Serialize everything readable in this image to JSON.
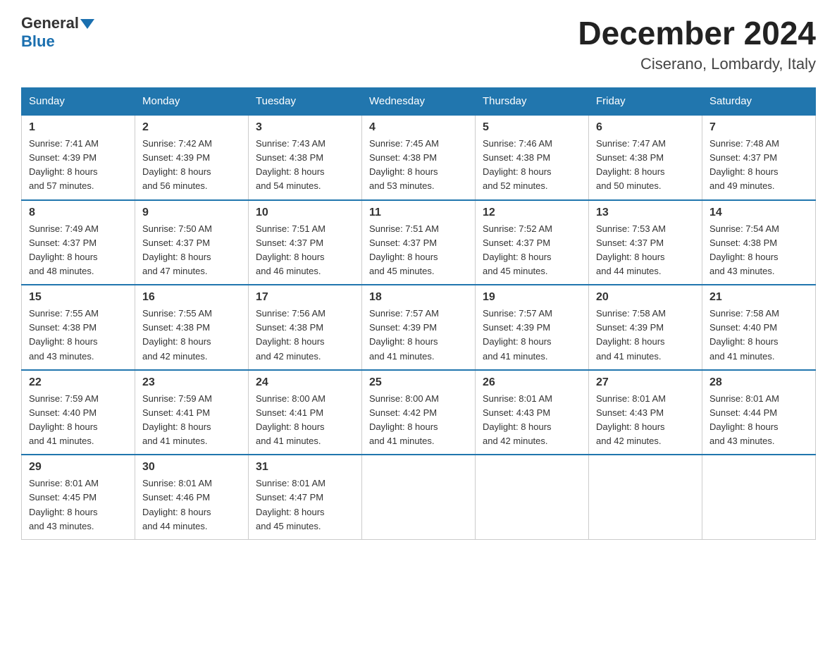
{
  "logo": {
    "line1": "General",
    "line2": "Blue"
  },
  "title": "December 2024",
  "subtitle": "Ciserano, Lombardy, Italy",
  "days_of_week": [
    "Sunday",
    "Monday",
    "Tuesday",
    "Wednesday",
    "Thursday",
    "Friday",
    "Saturday"
  ],
  "weeks": [
    [
      {
        "num": "1",
        "sunrise": "7:41 AM",
        "sunset": "4:39 PM",
        "daylight": "8 hours and 57 minutes."
      },
      {
        "num": "2",
        "sunrise": "7:42 AM",
        "sunset": "4:39 PM",
        "daylight": "8 hours and 56 minutes."
      },
      {
        "num": "3",
        "sunrise": "7:43 AM",
        "sunset": "4:38 PM",
        "daylight": "8 hours and 54 minutes."
      },
      {
        "num": "4",
        "sunrise": "7:45 AM",
        "sunset": "4:38 PM",
        "daylight": "8 hours and 53 minutes."
      },
      {
        "num": "5",
        "sunrise": "7:46 AM",
        "sunset": "4:38 PM",
        "daylight": "8 hours and 52 minutes."
      },
      {
        "num": "6",
        "sunrise": "7:47 AM",
        "sunset": "4:38 PM",
        "daylight": "8 hours and 50 minutes."
      },
      {
        "num": "7",
        "sunrise": "7:48 AM",
        "sunset": "4:37 PM",
        "daylight": "8 hours and 49 minutes."
      }
    ],
    [
      {
        "num": "8",
        "sunrise": "7:49 AM",
        "sunset": "4:37 PM",
        "daylight": "8 hours and 48 minutes."
      },
      {
        "num": "9",
        "sunrise": "7:50 AM",
        "sunset": "4:37 PM",
        "daylight": "8 hours and 47 minutes."
      },
      {
        "num": "10",
        "sunrise": "7:51 AM",
        "sunset": "4:37 PM",
        "daylight": "8 hours and 46 minutes."
      },
      {
        "num": "11",
        "sunrise": "7:51 AM",
        "sunset": "4:37 PM",
        "daylight": "8 hours and 45 minutes."
      },
      {
        "num": "12",
        "sunrise": "7:52 AM",
        "sunset": "4:37 PM",
        "daylight": "8 hours and 45 minutes."
      },
      {
        "num": "13",
        "sunrise": "7:53 AM",
        "sunset": "4:37 PM",
        "daylight": "8 hours and 44 minutes."
      },
      {
        "num": "14",
        "sunrise": "7:54 AM",
        "sunset": "4:38 PM",
        "daylight": "8 hours and 43 minutes."
      }
    ],
    [
      {
        "num": "15",
        "sunrise": "7:55 AM",
        "sunset": "4:38 PM",
        "daylight": "8 hours and 43 minutes."
      },
      {
        "num": "16",
        "sunrise": "7:55 AM",
        "sunset": "4:38 PM",
        "daylight": "8 hours and 42 minutes."
      },
      {
        "num": "17",
        "sunrise": "7:56 AM",
        "sunset": "4:38 PM",
        "daylight": "8 hours and 42 minutes."
      },
      {
        "num": "18",
        "sunrise": "7:57 AM",
        "sunset": "4:39 PM",
        "daylight": "8 hours and 41 minutes."
      },
      {
        "num": "19",
        "sunrise": "7:57 AM",
        "sunset": "4:39 PM",
        "daylight": "8 hours and 41 minutes."
      },
      {
        "num": "20",
        "sunrise": "7:58 AM",
        "sunset": "4:39 PM",
        "daylight": "8 hours and 41 minutes."
      },
      {
        "num": "21",
        "sunrise": "7:58 AM",
        "sunset": "4:40 PM",
        "daylight": "8 hours and 41 minutes."
      }
    ],
    [
      {
        "num": "22",
        "sunrise": "7:59 AM",
        "sunset": "4:40 PM",
        "daylight": "8 hours and 41 minutes."
      },
      {
        "num": "23",
        "sunrise": "7:59 AM",
        "sunset": "4:41 PM",
        "daylight": "8 hours and 41 minutes."
      },
      {
        "num": "24",
        "sunrise": "8:00 AM",
        "sunset": "4:41 PM",
        "daylight": "8 hours and 41 minutes."
      },
      {
        "num": "25",
        "sunrise": "8:00 AM",
        "sunset": "4:42 PM",
        "daylight": "8 hours and 41 minutes."
      },
      {
        "num": "26",
        "sunrise": "8:01 AM",
        "sunset": "4:43 PM",
        "daylight": "8 hours and 42 minutes."
      },
      {
        "num": "27",
        "sunrise": "8:01 AM",
        "sunset": "4:43 PM",
        "daylight": "8 hours and 42 minutes."
      },
      {
        "num": "28",
        "sunrise": "8:01 AM",
        "sunset": "4:44 PM",
        "daylight": "8 hours and 43 minutes."
      }
    ],
    [
      {
        "num": "29",
        "sunrise": "8:01 AM",
        "sunset": "4:45 PM",
        "daylight": "8 hours and 43 minutes."
      },
      {
        "num": "30",
        "sunrise": "8:01 AM",
        "sunset": "4:46 PM",
        "daylight": "8 hours and 44 minutes."
      },
      {
        "num": "31",
        "sunrise": "8:01 AM",
        "sunset": "4:47 PM",
        "daylight": "8 hours and 45 minutes."
      },
      null,
      null,
      null,
      null
    ]
  ],
  "labels": {
    "sunrise": "Sunrise:",
    "sunset": "Sunset:",
    "daylight": "Daylight:"
  }
}
